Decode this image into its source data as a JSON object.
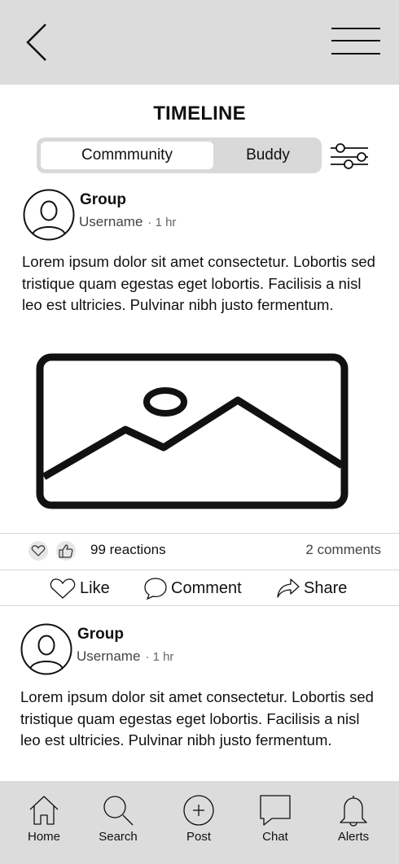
{
  "header": {
    "back_icon": "chevron-left-icon",
    "menu_icon": "hamburger-menu-icon"
  },
  "page": {
    "title": "TIMELINE"
  },
  "tabs": [
    {
      "label": "Commmunity",
      "active": true
    },
    {
      "label": "Buddy",
      "active": false
    }
  ],
  "filter_icon": "sliders-icon",
  "posts": [
    {
      "group": "Group",
      "username": "Username",
      "time": "· 1 hr",
      "text": "Lorem ipsum dolor sit amet consectetur. Lobortis sed tristique quam egestas eget lobortis. Facilisis a nisl leo est ultricies. Pulvinar nibh justo fermentum.",
      "image_icon": "image-placeholder-icon",
      "reactions": "99 reactions",
      "comments": "2 comments"
    },
    {
      "group": "Group",
      "username": "Username",
      "time": "· 1 hr",
      "text": "Lorem ipsum dolor sit amet consectetur. Lobortis sed tristique quam egestas eget lobortis. Facilisis a nisl leo est ultricies. Pulvinar nibh justo fermentum."
    }
  ],
  "actions": {
    "like": "Like",
    "comment": "Comment",
    "share": "Share"
  },
  "bottom_nav": [
    {
      "label": "Home",
      "icon": "home-icon"
    },
    {
      "label": "Search",
      "icon": "search-icon"
    },
    {
      "label": "Post",
      "icon": "plus-circle-icon"
    },
    {
      "label": "Chat",
      "icon": "chat-bubble-icon"
    },
    {
      "label": "Alerts",
      "icon": "bell-icon"
    }
  ],
  "colors": {
    "bar_bg": "#dcdcdc",
    "tab_bg": "#d9d9d9"
  }
}
